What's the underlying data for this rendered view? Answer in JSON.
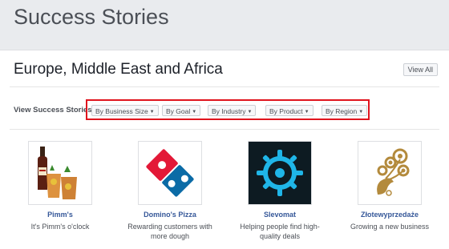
{
  "header": {
    "title": "Success Stories"
  },
  "region": {
    "title": "Europe, Middle East and Africa",
    "view_all": "View All"
  },
  "filters": {
    "label": "View Success Stories",
    "dropdowns": [
      "By Business Size",
      "By Goal",
      "By Industry",
      "By Product",
      "By Region"
    ],
    "highlight_color": "#e0141e"
  },
  "stories": [
    {
      "name": "Pimm's",
      "description": "It's Pimm's o'clock",
      "logo": "pimms-drinks-image"
    },
    {
      "name": "Domino's Pizza",
      "description": "Rewarding customers with more dough",
      "logo": "dominos-logo"
    },
    {
      "name": "Slevomat",
      "description": "Helping people find high-quality deals",
      "logo": "slevomat-gear-logo"
    },
    {
      "name": "Złotewyprzedaże",
      "description": "Growing a new business",
      "logo": "zlotewyprzedaze-peacock-logo"
    }
  ],
  "colors": {
    "link": "#365899",
    "dominos_blue": "#0b6ba6",
    "dominos_red": "#e31837",
    "slevomat_cyan": "#1fb6e8",
    "gold": "#b38a3c"
  }
}
